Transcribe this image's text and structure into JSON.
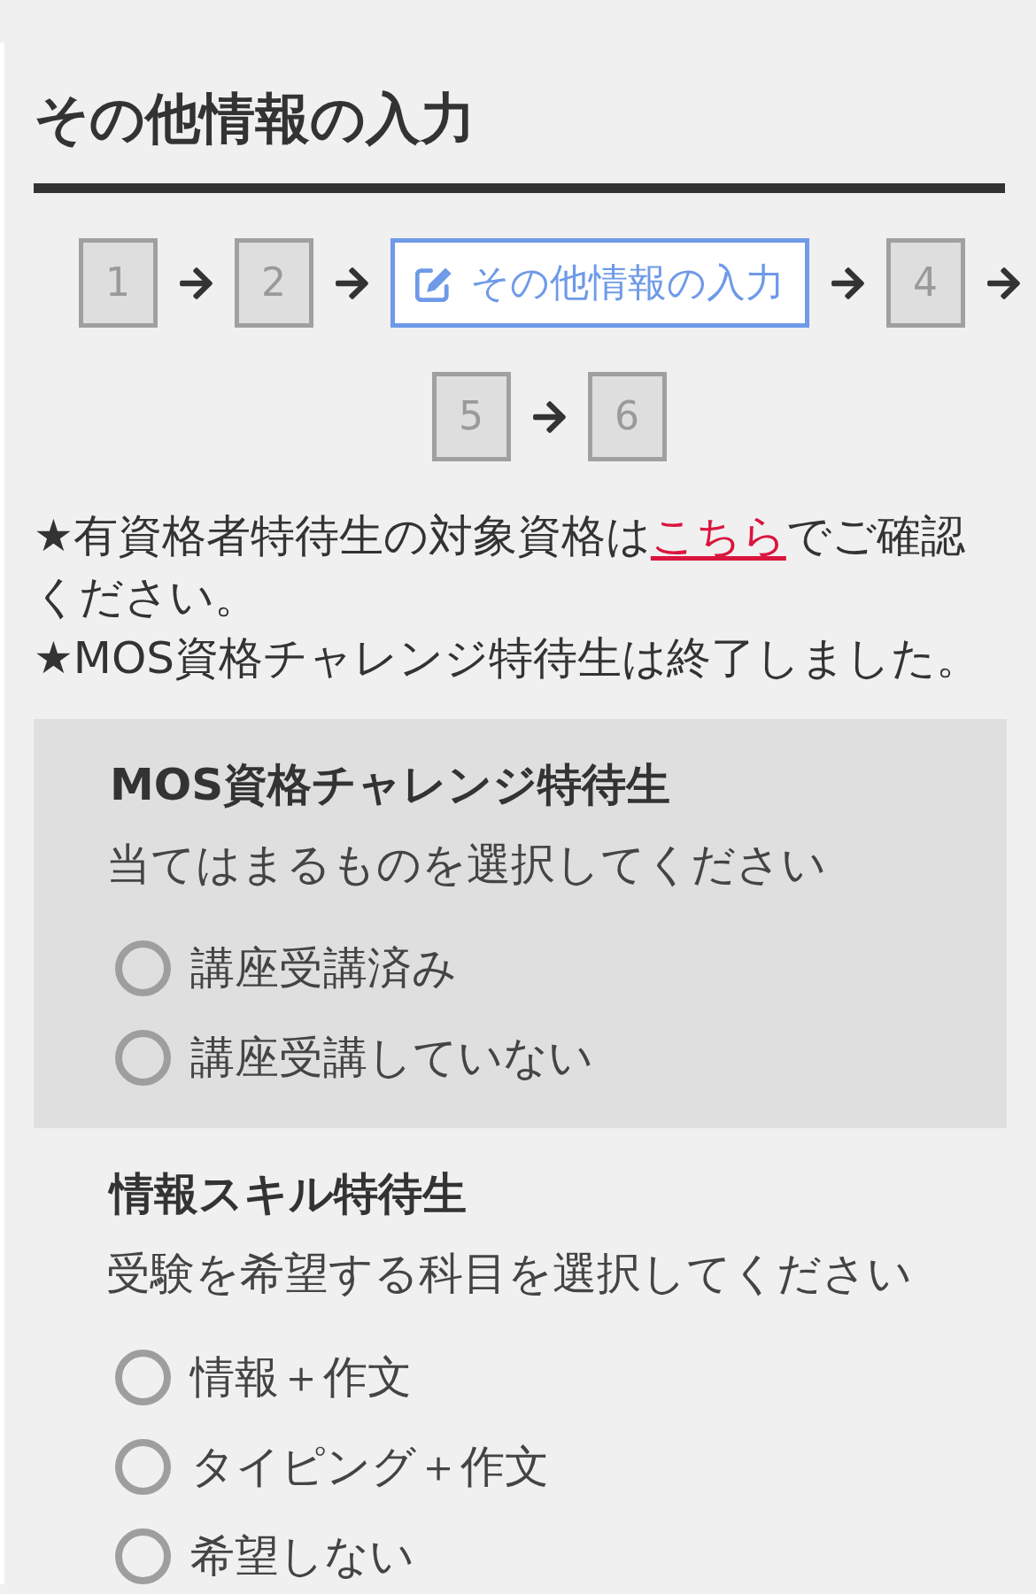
{
  "page_title": "その他情報の入力",
  "steps": [
    {
      "label": "1",
      "selected": false
    },
    {
      "label": "2",
      "selected": false
    },
    {
      "label": "その他情報の入力",
      "selected": true
    },
    {
      "label": "4",
      "selected": false
    },
    {
      "label": "5",
      "selected": false
    },
    {
      "label": "6",
      "selected": false
    }
  ],
  "notices": [
    {
      "text": "★有資格者特待生の対象資格は",
      "link": "こちら",
      "text_after": "でご確認ください。"
    },
    {
      "text": "★MOS資格チャレンジ特待生は終了しました。"
    }
  ],
  "sections": [
    {
      "title": "MOS資格チャレンジ特待生",
      "highlighted": true,
      "prompt": "当てはまるものを選択してください",
      "options": [
        {
          "label": "講座受講済み",
          "selected": false
        },
        {
          "label": "講座受講していない",
          "selected": false
        }
      ]
    },
    {
      "title": "情報スキル特待生",
      "highlighted": false,
      "prompt": "受験を希望する科目を選択してください",
      "options": [
        {
          "label": "情報＋作文",
          "selected": false
        },
        {
          "label": "タイピング＋作文",
          "selected": false
        },
        {
          "label": "希望しない",
          "selected": false
        }
      ]
    }
  ]
}
